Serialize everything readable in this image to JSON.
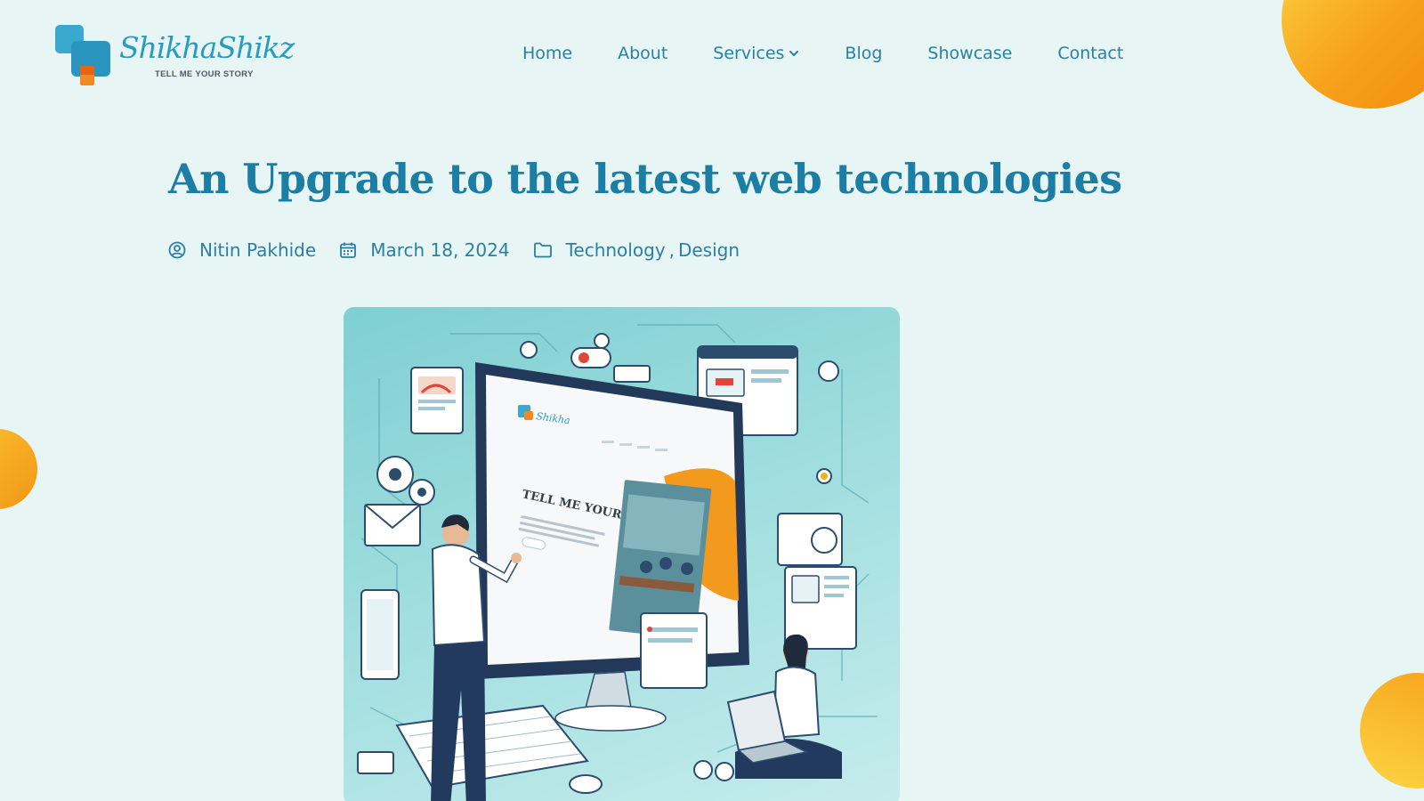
{
  "brand": {
    "name": "ShikhaShikz",
    "tagline": "TELL ME YOUR STORY"
  },
  "nav": {
    "items": [
      {
        "label": "Home"
      },
      {
        "label": "About"
      },
      {
        "label": "Services"
      },
      {
        "label": "Blog"
      },
      {
        "label": "Showcase"
      },
      {
        "label": "Contact"
      }
    ]
  },
  "post": {
    "title": "An Upgrade to the latest web technologies",
    "author": "Nitin Pakhide",
    "date": "March 18, 2024",
    "categories": [
      "Technology",
      "Design"
    ],
    "category_separator": ",",
    "hero_screen_text": "TELL ME YOUR STORY"
  },
  "colors": {
    "background": "#e8f5f5",
    "primary": "#1c7ea5",
    "accent_orange": "#f7a21c",
    "accent_yellow": "#fbd543"
  },
  "icons": {
    "author": "user-circle-icon",
    "date": "calendar-icon",
    "categories": "folder-icon",
    "services": "chevron-down-icon"
  }
}
